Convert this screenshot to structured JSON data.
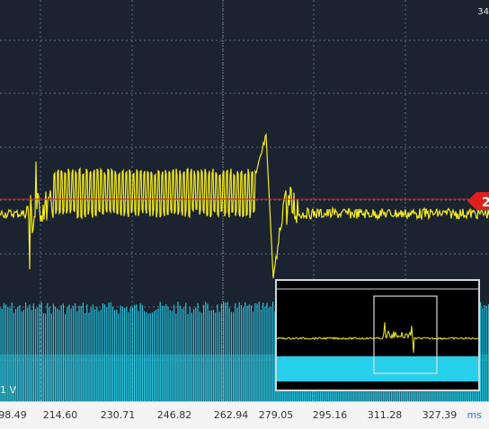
{
  "header": {
    "corner_label": "34"
  },
  "channel": {
    "scale_label": "1 V",
    "marker": "2"
  },
  "colors": {
    "ch1": "#f5ec1d",
    "ch2": "#27d0ea",
    "trigger": "#e0201a",
    "grid": "#5c6b78",
    "bg": "#1b2330"
  },
  "x_axis": {
    "unit": "ms",
    "ticks": [
      "98.49",
      "214.60",
      "230.71",
      "246.82",
      "262.94",
      "279.05",
      "295.16",
      "311.28",
      "327.39"
    ]
  }
}
